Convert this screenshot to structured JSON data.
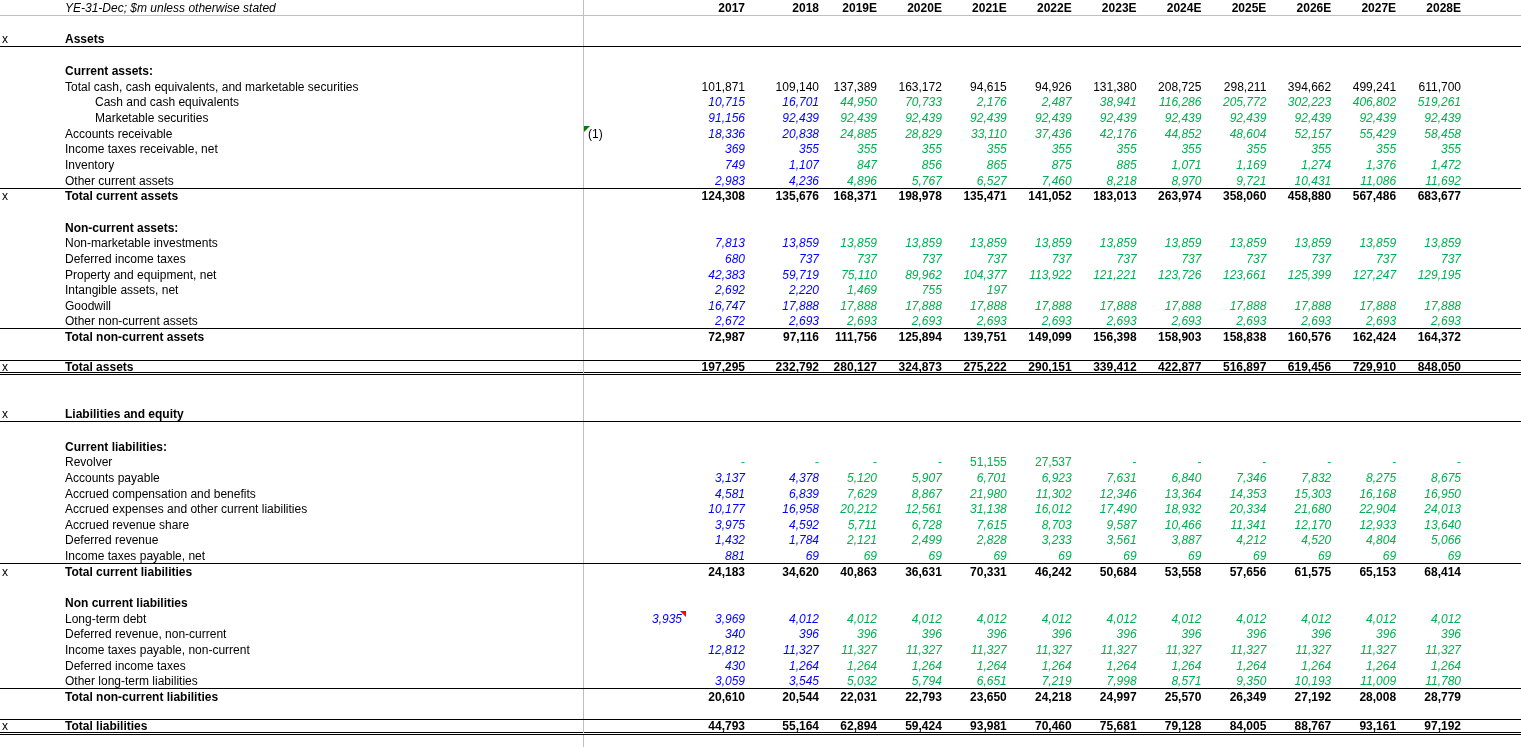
{
  "sheet": {
    "caption": "YE-31-Dec; $m unless otherwise stated",
    "years": [
      "2017",
      "2018",
      "2019E",
      "2020E",
      "2021E",
      "2022E",
      "2023E",
      "2024E",
      "2025E",
      "2026E",
      "2027E",
      "2028E"
    ],
    "rows": [
      {
        "kind": "section",
        "marker": "x",
        "label": "Assets"
      },
      {
        "kind": "subheader",
        "label": "Current assets:"
      },
      {
        "kind": "formula",
        "label": "Total cash, cash equivalents, and marketable securities",
        "values": [
          "101,871",
          "109,140",
          "137,389",
          "163,172",
          "94,615",
          "94,926",
          "131,380",
          "208,725",
          "298,211",
          "394,662",
          "499,241",
          "611,700"
        ],
        "children": [
          {
            "kind": "item",
            "label": "Cash and cash equivalents",
            "actuals": [
              "10,715",
              "16,701"
            ],
            "forecasts": [
              "44,950",
              "70,733",
              "2,176",
              "2,487",
              "38,941",
              "116,286",
              "205,772",
              "302,223",
              "406,802",
              "519,261"
            ]
          },
          {
            "kind": "item",
            "label": "Marketable securities",
            "actuals": [
              "91,156",
              "92,439"
            ],
            "forecasts": [
              "92,439",
              "92,439",
              "92,439",
              "92,439",
              "92,439",
              "92,439",
              "92,439",
              "92,439",
              "92,439",
              "92,439"
            ]
          }
        ]
      },
      {
        "kind": "item",
        "label": "Accounts receivable",
        "note": {
          "text": "(1)",
          "kind": "plain",
          "flagged": true
        },
        "actuals": [
          "18,336",
          "20,838"
        ],
        "forecasts": [
          "24,885",
          "28,829",
          "33,110",
          "37,436",
          "42,176",
          "44,852",
          "48,604",
          "52,157",
          "55,429",
          "58,458"
        ]
      },
      {
        "kind": "item",
        "label": "Income taxes receivable, net",
        "actuals": [
          "369",
          "355"
        ],
        "forecasts": [
          "355",
          "355",
          "355",
          "355",
          "355",
          "355",
          "355",
          "355",
          "355",
          "355"
        ]
      },
      {
        "kind": "item",
        "label": "Inventory",
        "actuals": [
          "749",
          "1,107"
        ],
        "forecasts": [
          "847",
          "856",
          "865",
          "875",
          "885",
          "1,071",
          "1,169",
          "1,274",
          "1,376",
          "1,472"
        ]
      },
      {
        "kind": "item",
        "label": "Other current assets",
        "actuals": [
          "2,983",
          "4,236"
        ],
        "forecasts": [
          "4,896",
          "5,767",
          "6,527",
          "7,460",
          "8,218",
          "8,970",
          "9,721",
          "10,431",
          "11,086",
          "11,692"
        ]
      },
      {
        "kind": "total",
        "marker": "x",
        "label": "Total current assets",
        "values": [
          "124,308",
          "135,676",
          "168,371",
          "198,978",
          "135,471",
          "141,052",
          "183,013",
          "263,974",
          "358,060",
          "458,880",
          "567,486",
          "683,677"
        ]
      },
      {
        "kind": "subheader",
        "label": "Non-current assets:"
      },
      {
        "kind": "item",
        "label": "Non-marketable investments",
        "actuals": [
          "7,813",
          "13,859"
        ],
        "forecasts": [
          "13,859",
          "13,859",
          "13,859",
          "13,859",
          "13,859",
          "13,859",
          "13,859",
          "13,859",
          "13,859",
          "13,859"
        ]
      },
      {
        "kind": "item",
        "label": "Deferred income taxes",
        "actuals": [
          "680",
          "737"
        ],
        "forecasts": [
          "737",
          "737",
          "737",
          "737",
          "737",
          "737",
          "737",
          "737",
          "737",
          "737"
        ]
      },
      {
        "kind": "item",
        "label": "Property and equipment, net",
        "actuals": [
          "42,383",
          "59,719"
        ],
        "forecasts": [
          "75,110",
          "89,962",
          "104,377",
          "113,922",
          "121,221",
          "123,726",
          "123,661",
          "125,399",
          "127,247",
          "129,195"
        ]
      },
      {
        "kind": "item",
        "label": "Intangible assets, net",
        "actuals": [
          "2,692",
          "2,220"
        ],
        "forecasts": [
          "1,469",
          "755",
          "197"
        ]
      },
      {
        "kind": "item",
        "label": "Goodwill",
        "actuals": [
          "16,747",
          "17,888"
        ],
        "forecasts": [
          "17,888",
          "17,888",
          "17,888",
          "17,888",
          "17,888",
          "17,888",
          "17,888",
          "17,888",
          "17,888",
          "17,888"
        ]
      },
      {
        "kind": "item",
        "label": "Other non-current assets",
        "actuals": [
          "2,672",
          "2,693"
        ],
        "forecasts": [
          "2,693",
          "2,693",
          "2,693",
          "2,693",
          "2,693",
          "2,693",
          "2,693",
          "2,693",
          "2,693",
          "2,693"
        ]
      },
      {
        "kind": "total",
        "label": "Total non-current assets",
        "values": [
          "72,987",
          "97,116",
          "111,756",
          "125,894",
          "139,751",
          "149,099",
          "156,398",
          "158,903",
          "158,838",
          "160,576",
          "162,424",
          "164,372"
        ]
      },
      {
        "kind": "grand_total",
        "marker": "x",
        "label": "Total assets",
        "values": [
          "197,295",
          "232,792",
          "280,127",
          "324,873",
          "275,222",
          "290,151",
          "339,412",
          "422,877",
          "516,897",
          "619,456",
          "729,910",
          "848,050"
        ]
      },
      {
        "kind": "section",
        "marker": "x",
        "label": "Liabilities and equity"
      },
      {
        "kind": "subheader",
        "label": "Current liabilities:"
      },
      {
        "kind": "linked",
        "label": "Revolver",
        "values": [
          "-",
          "-",
          "-",
          "-",
          "51,155",
          "27,537",
          "-",
          "-",
          "-",
          "-",
          "-",
          "-"
        ]
      },
      {
        "kind": "item",
        "label": "Accounts payable",
        "actuals": [
          "3,137",
          "4,378"
        ],
        "forecasts": [
          "5,120",
          "5,907",
          "6,701",
          "6,923",
          "7,631",
          "6,840",
          "7,346",
          "7,832",
          "8,275",
          "8,675"
        ]
      },
      {
        "kind": "item",
        "label": "Accrued compensation and benefits",
        "actuals": [
          "4,581",
          "6,839"
        ],
        "forecasts": [
          "7,629",
          "8,867",
          "21,980",
          "11,302",
          "12,346",
          "13,364",
          "14,353",
          "15,303",
          "16,168",
          "16,950"
        ]
      },
      {
        "kind": "item",
        "label": "Accrued expenses and other current liabilities",
        "actuals": [
          "10,177",
          "16,958"
        ],
        "forecasts": [
          "20,212",
          "12,561",
          "31,138",
          "16,012",
          "17,490",
          "18,932",
          "20,334",
          "21,680",
          "22,904",
          "24,013"
        ]
      },
      {
        "kind": "item",
        "label": "Accrued revenue share",
        "actuals": [
          "3,975",
          "4,592"
        ],
        "forecasts": [
          "5,711",
          "6,728",
          "7,615",
          "8,703",
          "9,587",
          "10,466",
          "11,341",
          "12,170",
          "12,933",
          "13,640"
        ]
      },
      {
        "kind": "item",
        "label": "Deferred revenue",
        "actuals": [
          "1,432",
          "1,784"
        ],
        "forecasts": [
          "2,121",
          "2,499",
          "2,828",
          "3,233",
          "3,561",
          "3,887",
          "4,212",
          "4,520",
          "4,804",
          "5,066"
        ]
      },
      {
        "kind": "item",
        "label": "Income taxes payable, net",
        "actuals": [
          "881",
          "69"
        ],
        "forecasts": [
          "69",
          "69",
          "69",
          "69",
          "69",
          "69",
          "69",
          "69",
          "69",
          "69"
        ]
      },
      {
        "kind": "total",
        "marker": "x",
        "label": "Total current liabilities",
        "values": [
          "24,183",
          "34,620",
          "40,863",
          "36,631",
          "70,331",
          "46,242",
          "50,684",
          "53,558",
          "57,656",
          "61,575",
          "65,153",
          "68,414"
        ]
      },
      {
        "kind": "subheader",
        "label": "Non current liabilities"
      },
      {
        "kind": "item",
        "label": "Long-term debt",
        "note": {
          "text": "3,935",
          "kind": "input",
          "commented": true
        },
        "actuals": [
          "3,969",
          "4,012"
        ],
        "forecasts": [
          "4,012",
          "4,012",
          "4,012",
          "4,012",
          "4,012",
          "4,012",
          "4,012",
          "4,012",
          "4,012",
          "4,012"
        ]
      },
      {
        "kind": "item",
        "label": "Deferred revenue, non-current",
        "actuals": [
          "340",
          "396"
        ],
        "forecasts": [
          "396",
          "396",
          "396",
          "396",
          "396",
          "396",
          "396",
          "396",
          "396",
          "396"
        ]
      },
      {
        "kind": "item",
        "label": "Income taxes payable, non-current",
        "actuals": [
          "12,812",
          "11,327"
        ],
        "forecasts": [
          "11,327",
          "11,327",
          "11,327",
          "11,327",
          "11,327",
          "11,327",
          "11,327",
          "11,327",
          "11,327",
          "11,327"
        ]
      },
      {
        "kind": "item",
        "label": "Deferred income taxes",
        "actuals": [
          "430",
          "1,264"
        ],
        "forecasts": [
          "1,264",
          "1,264",
          "1,264",
          "1,264",
          "1,264",
          "1,264",
          "1,264",
          "1,264",
          "1,264",
          "1,264"
        ]
      },
      {
        "kind": "item",
        "label": "Other long-term liabilities",
        "actuals": [
          "3,059",
          "3,545"
        ],
        "forecasts": [
          "5,032",
          "5,794",
          "6,651",
          "7,219",
          "7,998",
          "8,571",
          "9,350",
          "10,193",
          "11,009",
          "11,780"
        ]
      },
      {
        "kind": "total",
        "label": "Total non-current liabilities",
        "values": [
          "20,610",
          "20,544",
          "22,031",
          "22,793",
          "23,650",
          "24,218",
          "24,997",
          "25,570",
          "26,349",
          "27,192",
          "28,008",
          "28,779"
        ]
      },
      {
        "kind": "grand_total",
        "marker": "x",
        "label": "Total liabilities",
        "values": [
          "44,793",
          "55,164",
          "62,894",
          "59,424",
          "93,981",
          "70,460",
          "75,681",
          "79,128",
          "84,005",
          "88,767",
          "93,161",
          "97,192"
        ]
      }
    ]
  }
}
